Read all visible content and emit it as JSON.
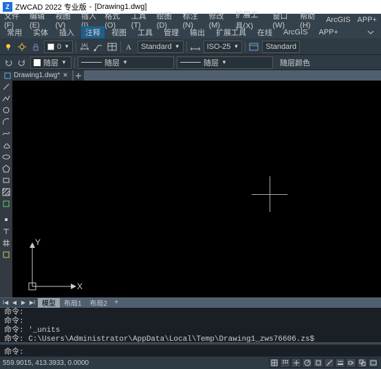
{
  "titlebar": {
    "app": "ZWCAD 2022 专业版",
    "doc": "[Drawing1.dwg]"
  },
  "menu": [
    "文件(F)",
    "编辑(E)",
    "视图(V)",
    "插入(I)",
    "格式(O)",
    "工具(T)",
    "绘图(D)",
    "标注(N)",
    "修改(M)",
    "扩展工具(X)",
    "窗口(W)",
    "帮助(H)",
    "ArcGIS",
    "APP+"
  ],
  "ribbontabs": [
    "常用",
    "实体",
    "插入",
    "注释",
    "视图",
    "工具",
    "管理",
    "输出",
    "扩展工具",
    "在线",
    "ArcGIS",
    "APP+"
  ],
  "active_ribbon_index": 3,
  "toolbar": {
    "textstyle": "Standard",
    "dimstyle": "ISO-25",
    "tablestyle": "Standard",
    "color_label": "随层颜色",
    "lw_label": "随层",
    "lt_label": "随层",
    "layer_value": "0"
  },
  "filetab": {
    "name": "Drawing1.dwg*"
  },
  "modeltabs": {
    "model": "模型",
    "layout1": "布局1",
    "layout2": "布局2"
  },
  "ucs": {
    "y": "Y",
    "x": "X"
  },
  "cmdhist": [
    "命令:",
    "命令:",
    "命令: '_units",
    "命令: C:\\Users\\Administrator\\AppData\\Local\\Temp\\Drawing1_zws76606.zs$"
  ],
  "cmd_prompt": "命令:",
  "cmd_value": "",
  "status": {
    "coords": "559.9015, 413.3933, 0.0000"
  },
  "icons": {
    "undo": "undo",
    "redo": "redo"
  }
}
